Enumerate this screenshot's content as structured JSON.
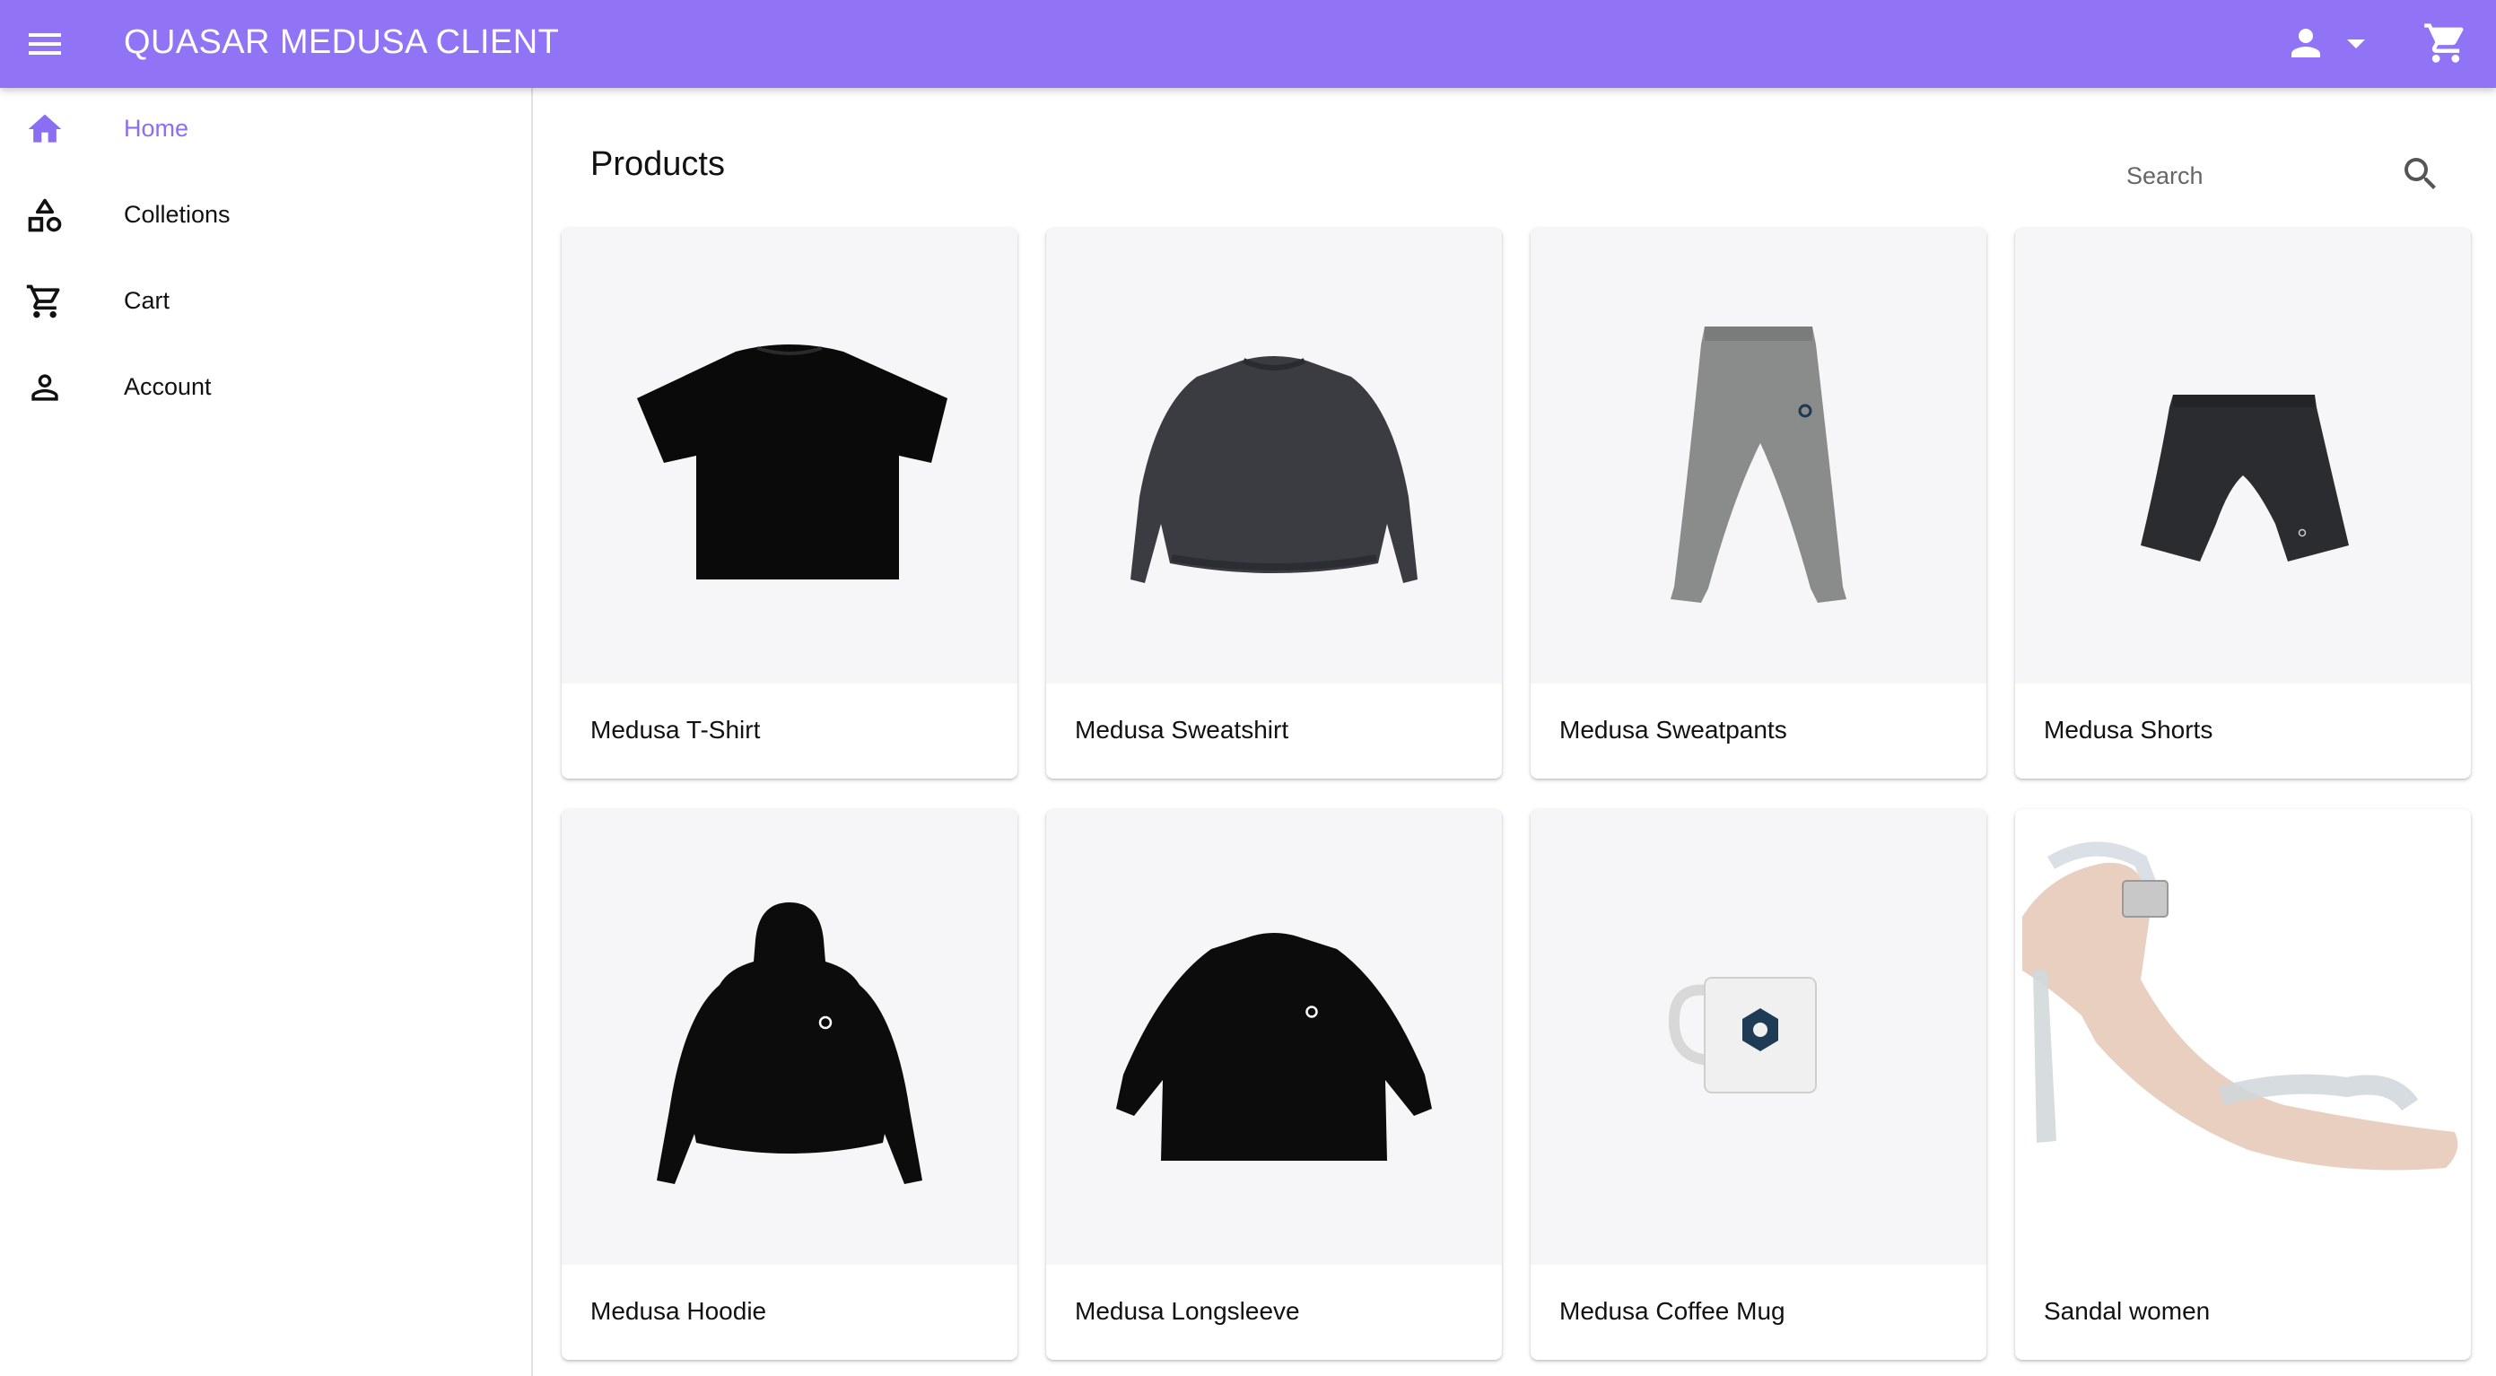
{
  "header": {
    "title": "QUASAR MEDUSA CLIENT",
    "color": "#9174f5",
    "icons": [
      "menu-icon",
      "person-icon",
      "arrow-drop-down-icon",
      "shopping-cart-icon"
    ]
  },
  "sidebar": {
    "items": [
      {
        "label": "Home",
        "icon": "home-icon",
        "active": true
      },
      {
        "label": "Colletions",
        "icon": "category-icon"
      },
      {
        "label": "Cart",
        "icon": "cart-icon"
      },
      {
        "label": "Account",
        "icon": "person-outline-icon"
      }
    ],
    "active_color": "#8b6ef2"
  },
  "main": {
    "title": "Products",
    "search": {
      "placeholder": "Search"
    },
    "products": [
      {
        "name": "Medusa T-Shirt"
      },
      {
        "name": "Medusa Sweatshirt"
      },
      {
        "name": "Medusa Sweatpants"
      },
      {
        "name": "Medusa Shorts"
      },
      {
        "name": "Medusa Hoodie"
      },
      {
        "name": "Medusa Longsleeve"
      },
      {
        "name": "Medusa Coffee Mug"
      },
      {
        "name": "Sandal women"
      }
    ]
  }
}
